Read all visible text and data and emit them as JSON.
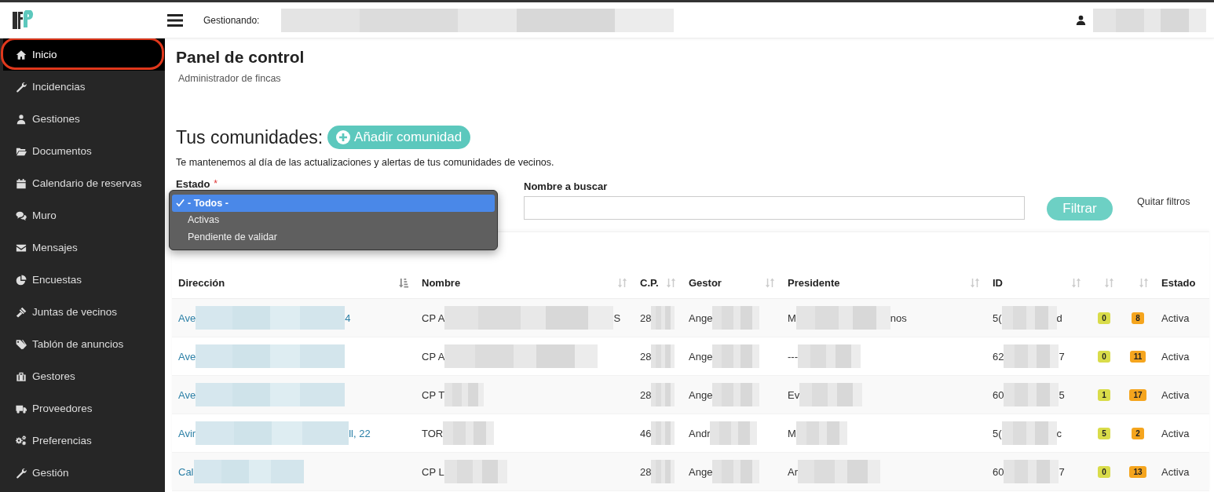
{
  "topbar": {
    "managing_label": "Gestionando:"
  },
  "sidebar": {
    "items": [
      {
        "label": "Inicio",
        "selected": true,
        "circled": true
      },
      {
        "label": "Incidencias",
        "selected": false,
        "circled": false
      },
      {
        "label": "Gestiones",
        "selected": false,
        "circled": false
      },
      {
        "label": "Documentos",
        "selected": false,
        "circled": false
      },
      {
        "label": "Calendario de reservas",
        "selected": false,
        "circled": false
      },
      {
        "label": "Muro",
        "selected": false,
        "circled": false
      },
      {
        "label": "Mensajes",
        "selected": false,
        "circled": false
      },
      {
        "label": "Encuestas",
        "selected": false,
        "circled": false
      },
      {
        "label": "Juntas de vecinos",
        "selected": false,
        "circled": false
      },
      {
        "label": "Tablón de anuncios",
        "selected": false,
        "circled": false
      },
      {
        "label": "Gestores",
        "selected": false,
        "circled": false
      },
      {
        "label": "Proveedores",
        "selected": false,
        "circled": false
      },
      {
        "label": "Preferencias",
        "selected": false,
        "circled": false
      },
      {
        "label": "Gestión",
        "selected": false,
        "circled": false
      }
    ]
  },
  "page": {
    "title": "Panel de control",
    "subtitle": "Administrador de fincas"
  },
  "communities": {
    "heading": "Tus comunidades:",
    "add_button": "Añadir comunidad",
    "description": "Te mantenemos al día de las actualizaciones y alertas de tus comunidades de vecinos."
  },
  "filters": {
    "estado_label": "Estado",
    "required_mark": "*",
    "estado_options": [
      {
        "label": "- Todos -",
        "selected": true
      },
      {
        "label": "Activas",
        "selected": false
      },
      {
        "label": "Pendiente de validar",
        "selected": false
      }
    ],
    "name_label": "Nombre a buscar",
    "filter_button": "Filtrar",
    "clear_link": "Quitar filtros"
  },
  "table": {
    "columns": [
      {
        "label": "Dirección",
        "sort_active": true
      },
      {
        "label": "Nombre",
        "sort_active": false
      },
      {
        "label": "C.P.",
        "sort_active": false
      },
      {
        "label": "Gestor",
        "sort_active": false
      },
      {
        "label": "Presidente",
        "sort_active": false
      },
      {
        "label": "ID",
        "sort_active": false
      },
      {
        "sort_active": false
      },
      {
        "sort_active": false
      },
      {
        "label": "Estado"
      }
    ],
    "rows": [
      {
        "direccion": [
          "Ave",
          "4"
        ],
        "nombre": [
          "CP A",
          "S"
        ],
        "cp": "28",
        "gestor": "Ange",
        "presidente": [
          "M",
          "nos"
        ],
        "id": [
          "5(",
          "d"
        ],
        "count_1": "0",
        "count_2": "8",
        "estado": "Activa"
      },
      {
        "direccion": [
          "Ave"
        ],
        "nombre": [
          "CP A"
        ],
        "cp": "28",
        "gestor": "Ange",
        "presidente": [
          "---"
        ],
        "id": [
          "62",
          "7"
        ],
        "count_1": "0",
        "count_2": "11",
        "estado": "Activa"
      },
      {
        "direccion": [
          "Ave"
        ],
        "nombre": [
          "CP T"
        ],
        "cp": "28",
        "gestor": "Ange",
        "presidente": [
          "Ev"
        ],
        "id": [
          "60",
          "5"
        ],
        "count_1": "1",
        "count_2": "17",
        "estado": "Activa"
      },
      {
        "direccion": [
          "Avir",
          "ll, 22"
        ],
        "nombre": [
          "TOR"
        ],
        "cp": "46",
        "gestor": "Andr",
        "presidente": [
          "M"
        ],
        "id": [
          "5(",
          "c"
        ],
        "count_1": "5",
        "count_2": "2",
        "estado": "Activa"
      },
      {
        "direccion": [
          "Cal"
        ],
        "nombre": [
          "CP L"
        ],
        "cp": "28",
        "gestor": "Ange",
        "presidente": [
          "Ar"
        ],
        "id": [
          "60",
          "7"
        ],
        "count_1": "0",
        "count_2": "13",
        "estado": "Activa"
      }
    ]
  }
}
